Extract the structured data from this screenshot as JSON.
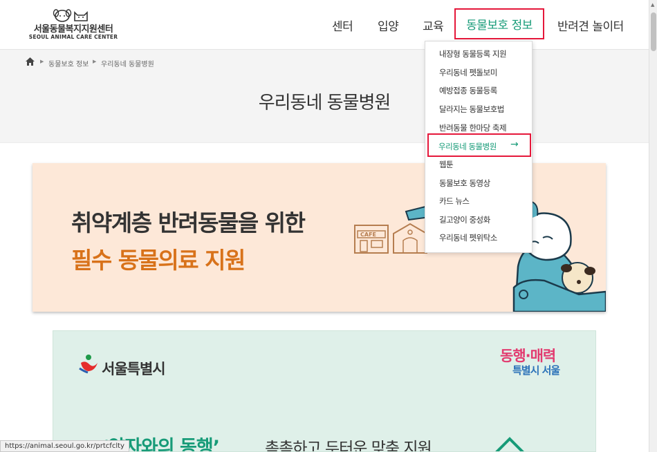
{
  "header": {
    "logo_ko": "서울동물복지지원센터",
    "logo_en": "SEOUL ANIMAL CARE CENTER",
    "nav": [
      "센터",
      "입양",
      "교육",
      "동물보호 정보",
      "반려견 놀이터"
    ]
  },
  "breadcrumb": {
    "home_icon": "home-icon",
    "items": [
      "동물보호 정보",
      "우리동네 동물병원"
    ]
  },
  "page_title": "우리동네 동물병원",
  "dropdown": {
    "items": [
      "내장형 동물등록 지원",
      "우리동네 펫돌보미",
      "예방접종 동물등록",
      "달라지는 동물보호법",
      "반려동물 한마당 축제",
      "우리동네 동물병원",
      "웹툰",
      "동물보호 동영상",
      "카드 뉴스",
      "길고양이 중성화",
      "우리동네 펫위탁소"
    ],
    "active_arrow": "→"
  },
  "banner1": {
    "line1": "취약계층 반려동물을 위한",
    "line2": "필수 동물의료 지원",
    "sign": "CAFE"
  },
  "banner2": {
    "seoul": "서울특별시",
    "slogan1": "동행·매력",
    "slogan2": "특별시 서울",
    "headline_green": "‘약자와의 동행’",
    "headline_rest": "촘촘하고 두터운 맞춤 지원"
  },
  "status_url": "https://animal.seoul.go.kr/prtcfclty",
  "colors": {
    "accent": "#179b78",
    "highlight": "#e5173a",
    "orange": "#d8721a",
    "banner_bg": "#fde8d8",
    "banner2_bg": "#dff0e9"
  }
}
